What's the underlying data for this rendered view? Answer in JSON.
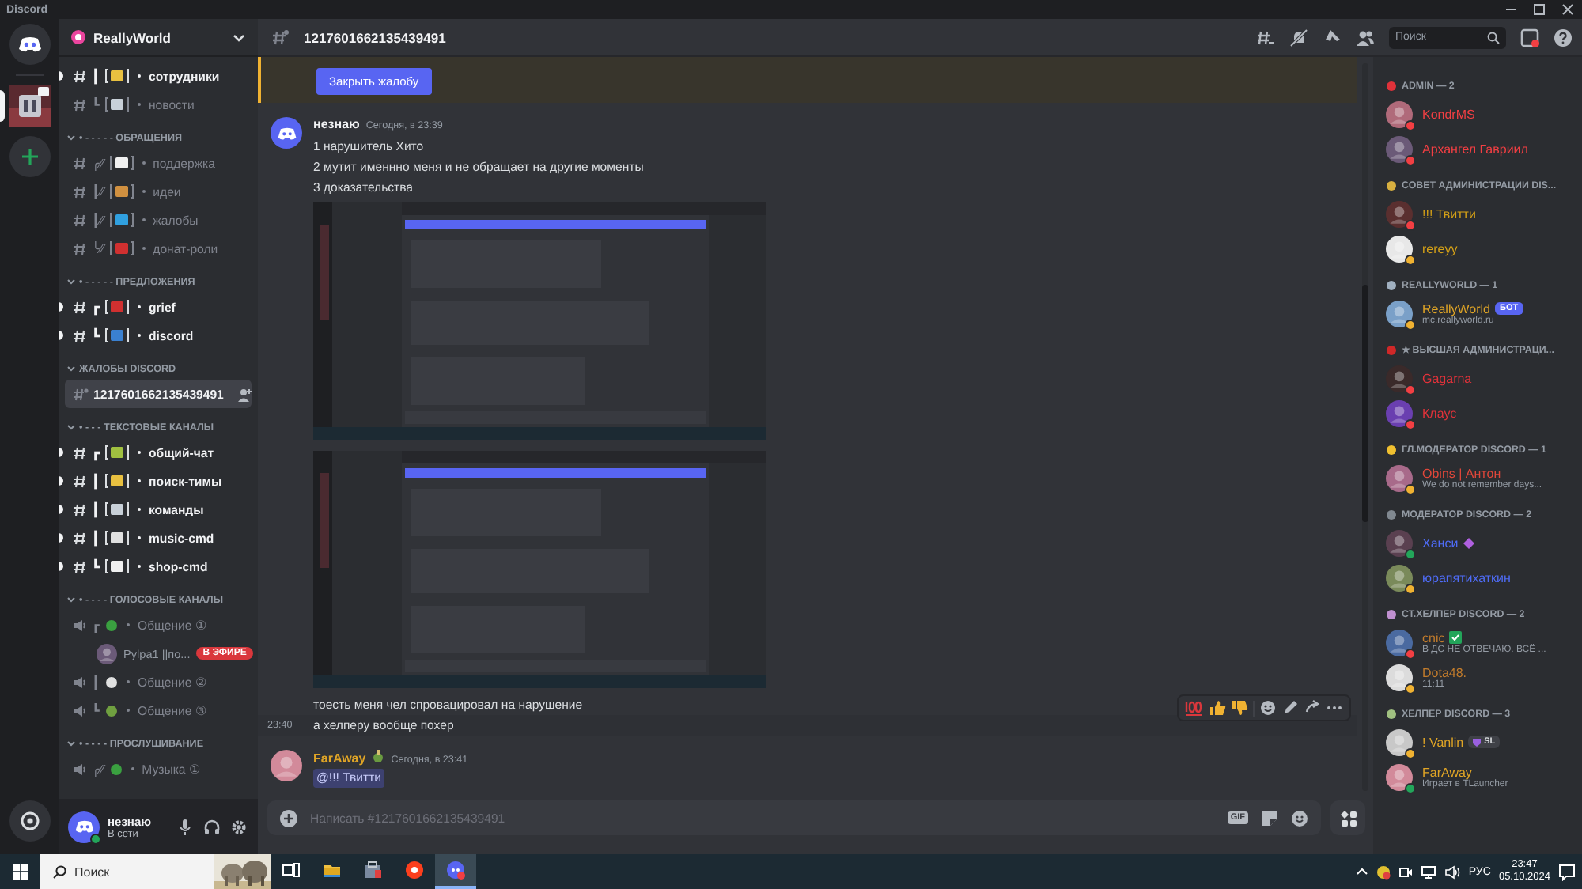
{
  "window": {
    "title": "Discord"
  },
  "servers": [
    {
      "kind": "home",
      "selected": false
    },
    {
      "kind": "guild",
      "selected": true
    }
  ],
  "sidebar": {
    "server_name": "ReallyWorld",
    "sections": [
      {
        "items": [
          {
            "kind": "text",
            "deco": "┃",
            "name": "сотрудники",
            "unread": true,
            "selected": false
          },
          {
            "kind": "text",
            "deco": "┗",
            "name": "новости",
            "unread": false,
            "selected": false
          }
        ]
      },
      {
        "title": "• - - - - - ОБРАЩЕНИЯ",
        "items": [
          {
            "kind": "text",
            "deco": "╭⁄⁄",
            "name": "поддержка",
            "unread": false,
            "selected": false
          },
          {
            "kind": "text",
            "deco": "┃⁄⁄",
            "name": "идеи",
            "unread": false,
            "selected": false
          },
          {
            "kind": "text",
            "deco": "┃⁄⁄",
            "name": "жалобы",
            "unread": false,
            "selected": false
          },
          {
            "kind": "text",
            "deco": "╰⁄⁄",
            "name": "донат-роли",
            "unread": false,
            "selected": false
          }
        ]
      },
      {
        "title": "• - - - - - ПРЕДЛОЖЕНИЯ",
        "items": [
          {
            "kind": "text",
            "deco": "┏",
            "name": "grief",
            "unread": true,
            "selected": false
          },
          {
            "kind": "text",
            "deco": "┗",
            "name": "discord",
            "unread": true,
            "selected": false
          }
        ]
      },
      {
        "title": "ЖАЛОБЫ DISCORD",
        "items": [
          {
            "kind": "ticket",
            "name": "1217601662135439491",
            "unread": false,
            "selected": true
          }
        ]
      },
      {
        "title": "• - - - ТЕКСТОВЫЕ КАНАЛЫ",
        "items": [
          {
            "kind": "text",
            "deco": "┏",
            "name": "общий-чат",
            "unread": true,
            "selected": false
          },
          {
            "kind": "text",
            "deco": "┃",
            "name": "поиск-тимы",
            "unread": true,
            "selected": false
          },
          {
            "kind": "text",
            "deco": "┃",
            "name": "команды",
            "unread": true,
            "selected": false
          },
          {
            "kind": "text",
            "deco": "┃",
            "name": "music-cmd",
            "unread": true,
            "selected": false
          },
          {
            "kind": "text",
            "deco": "┗",
            "name": "shop-cmd",
            "unread": true,
            "selected": false
          }
        ]
      },
      {
        "title": "• - - - - ГОЛОСОВЫЕ КАНАЛЫ",
        "items": [
          {
            "kind": "voice",
            "deco": "┏",
            "name": "Общение ①",
            "unread": false,
            "selected": false,
            "users": [
              {
                "name": "Pylpa1 ||по...",
                "badge": "В ЭФИРЕ"
              }
            ]
          },
          {
            "kind": "voice",
            "deco": "┃",
            "name": "Общение ②",
            "unread": false,
            "selected": false
          },
          {
            "kind": "voice",
            "deco": "┗",
            "name": "Общение ③",
            "unread": false,
            "selected": false
          }
        ]
      },
      {
        "title": "• - - - - ПРОСЛУШИВАНИЕ",
        "items": [
          {
            "kind": "voice",
            "deco": "╭⁄⁄",
            "name": "Музыка ①",
            "unread": false,
            "selected": false
          }
        ]
      }
    ],
    "user": {
      "name": "незнаю",
      "status_text": "В сети",
      "status": {
        "color": "#23a55a"
      }
    }
  },
  "header": {
    "channel": "1217601662135439491",
    "search_placeholder": "Поиск"
  },
  "chat": {
    "banner_button": "Закрыть жалобу",
    "messages": [
      {
        "author": "незнаю",
        "time": "Сегодня, в 23:39",
        "parts": [
          {
            "kind": "text",
            "text": "1 нарушитель Хито",
            "hovered": false
          },
          {
            "kind": "text",
            "text": "2 мутит именнно меня и не обращает на другие моменты",
            "hovered": false
          },
          {
            "kind": "text",
            "text": "3 доказательства",
            "hovered": false
          },
          {
            "kind": "picture"
          },
          {
            "kind": "picture"
          },
          {
            "kind": "text",
            "text": "тоесть меня чел спровацировал на нарушение",
            "hovered": false
          },
          {
            "kind": "text",
            "text": "а хелперу вообще похер",
            "stamp": "23:40",
            "hovered": true
          }
        ]
      },
      {
        "author": "FarAway",
        "color": "#e0a526",
        "time": "Сегодня, в 23:41",
        "parts": [
          {
            "kind": "mention",
            "text": "@!!! Твитти"
          }
        ]
      }
    ],
    "gif_label": "GIF",
    "composer_placeholder": "Написать #1217601662135439491"
  },
  "members": {
    "groups": [
      {
        "title": "ADMIN — 2",
        "members": [
          {
            "name": "KondrMS",
            "color": "#f23f43",
            "status": {
              "color": "#f23f43"
            }
          },
          {
            "name": "Архангел Гавриил",
            "color": "#f23f43",
            "status": {
              "color": "#f23f43"
            }
          }
        ]
      },
      {
        "title": "СОВЕТ АДМИНИСТРАЦИИ DIS...",
        "members": [
          {
            "name": "!!! Твитти",
            "color": "#d4a017",
            "status": {
              "color": "#f23f43"
            }
          },
          {
            "name": "rereyy",
            "color": "#d4a017",
            "status": {
              "color": "#f0b232"
            }
          }
        ]
      },
      {
        "title": "REALLYWORLD — 1",
        "members": [
          {
            "name": "ReallyWorld",
            "color": "#e0a526",
            "status": {
              "color": "#f0b232"
            },
            "badge": {
              "kind": "bot",
              "text": "БОТ"
            },
            "activity": "mc.reallyworld.ru"
          }
        ]
      },
      {
        "title": "★ ВЫСШАЯ АДМИНИСТРАЦИ...",
        "members": [
          {
            "name": "Gagarna",
            "color": "#e0323a",
            "status": {
              "color": "#f23f43"
            }
          },
          {
            "name": "Клаус",
            "color": "#e0323a",
            "status": {
              "color": "#f23f43"
            }
          }
        ]
      },
      {
        "title": "ГЛ.МОДЕРАТОР DISCORD — 1",
        "members": [
          {
            "name": "Obins | Антон",
            "color": "#e0473a",
            "status": {
              "color": "#f0b232"
            },
            "activity": "We do not remember days..."
          }
        ]
      },
      {
        "title": "МОДЕРАТОР DISCORD — 2",
        "members": [
          {
            "name": "Ханси",
            "color": "#4f6cf7",
            "status": {
              "color": "#23a55a"
            },
            "name_icon": {
              "kind": "gem"
            }
          },
          {
            "name": "юрапятихаткин",
            "color": "#4f6cf7",
            "status": {
              "color": "#f0b232"
            }
          }
        ]
      },
      {
        "title": "СТ.ХЕЛПЕР DISCORD — 2",
        "members": [
          {
            "name": "cnic",
            "color": "#c27c2c",
            "status": {
              "color": "#f23f43"
            },
            "name_icon": {
              "kind": "check"
            },
            "activity": "В ДС НЕ ОТВЕЧАЮ. ВСЁ ..."
          },
          {
            "name": "Dota48.",
            "color": "#c27c2c",
            "status": {
              "color": "#f0b232"
            },
            "activity": "11:11"
          }
        ]
      },
      {
        "title": "ХЕЛПЕР DISCORD — 3",
        "members": [
          {
            "name": "! Vanlin",
            "color": "#e0a526",
            "status": {
              "color": "#f0b232"
            },
            "badge": {
              "kind": "tag",
              "text": "SL"
            }
          },
          {
            "name": "FarAway",
            "color": "#e0a526",
            "status": {
              "color": "#23a55a"
            },
            "activity": "Играет в TLauncher"
          }
        ]
      }
    ]
  },
  "taskbar": {
    "search_placeholder": "Поиск",
    "apps": [
      {
        "kind": "taskview",
        "selected": false
      },
      {
        "kind": "explorer",
        "selected": false
      },
      {
        "kind": "store",
        "selected": false
      },
      {
        "kind": "yandex",
        "selected": false
      },
      {
        "kind": "discord",
        "selected": true
      }
    ],
    "language": "РУС",
    "time": "23:47",
    "date": "05.10.2024"
  }
}
